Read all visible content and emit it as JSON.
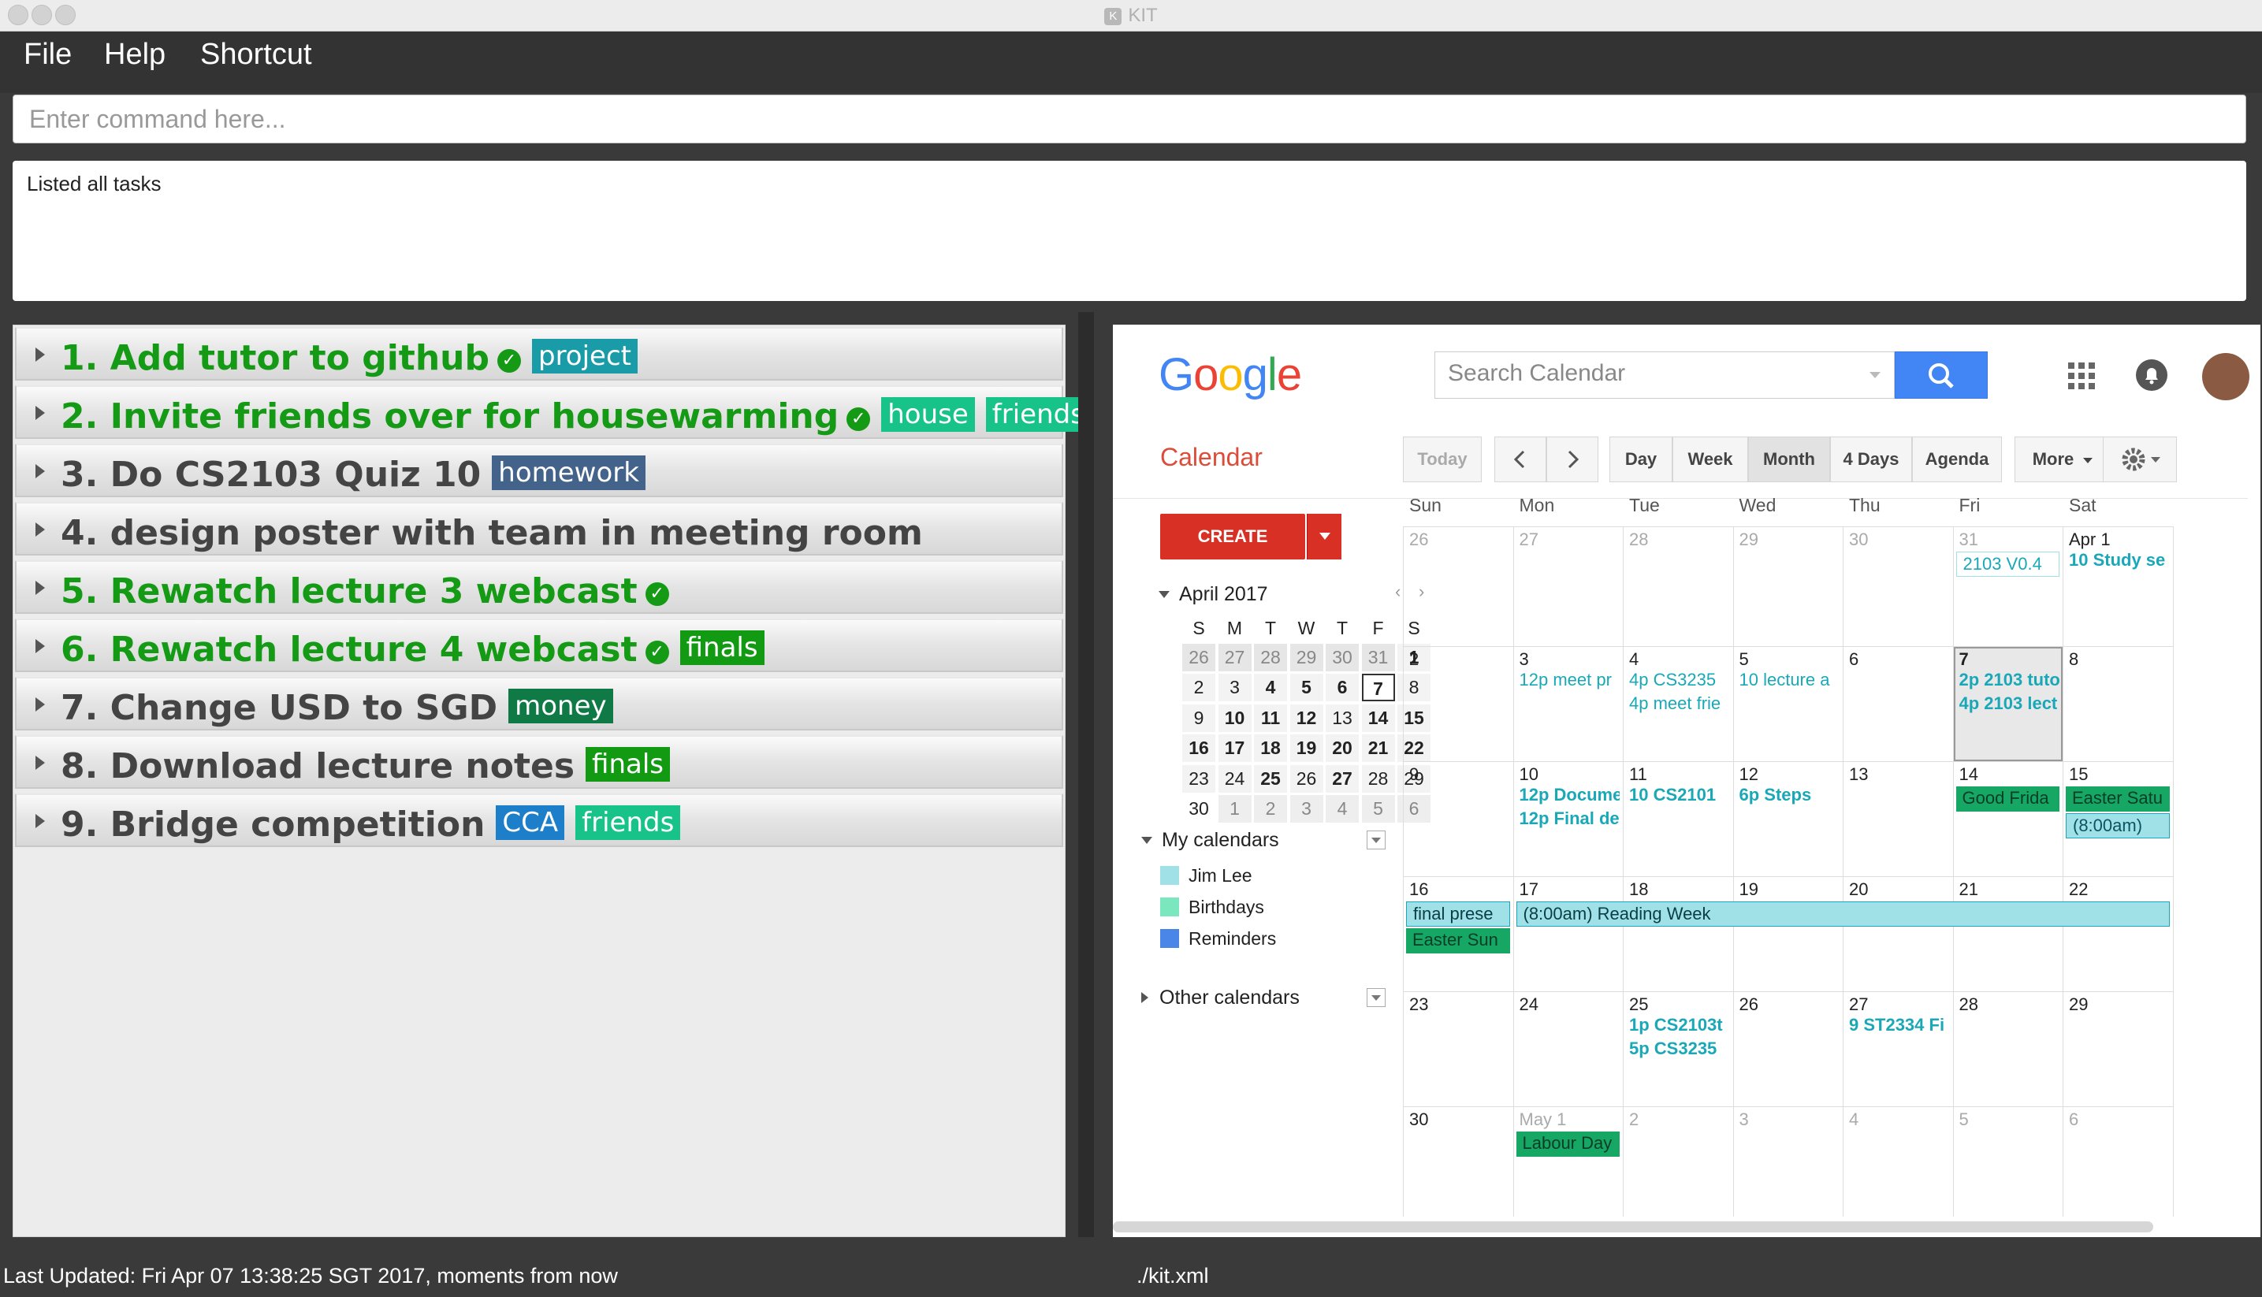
{
  "window": {
    "title": "KIT",
    "app_badge": "K"
  },
  "menu": {
    "file": "File",
    "help": "Help",
    "shortcut": "Shortcut"
  },
  "command": {
    "placeholder": "Enter command here..."
  },
  "result": {
    "text": "Listed all tasks"
  },
  "tasks": [
    {
      "title": "1. Add tutor to github",
      "done": true,
      "tags": [
        "project"
      ]
    },
    {
      "title": "2. Invite friends over for housewarming",
      "done": true,
      "tags": [
        "house",
        "friends"
      ]
    },
    {
      "title": "3. Do CS2103 Quiz 10",
      "done": false,
      "tags": [
        "homework"
      ]
    },
    {
      "title": "4. design poster with team in meeting room",
      "done": false,
      "tags": []
    },
    {
      "title": "5. Rewatch lecture 3 webcast",
      "done": true,
      "tags": []
    },
    {
      "title": "6. Rewatch lecture 4 webcast",
      "done": true,
      "tags": [
        "finals"
      ]
    },
    {
      "title": "7. Change USD to SGD",
      "done": false,
      "tags": [
        "money"
      ]
    },
    {
      "title": "8. Download lecture notes",
      "done": false,
      "tags": [
        "finals"
      ]
    },
    {
      "title": "9. Bridge competition",
      "done": false,
      "tags": [
        "CCA",
        "friends"
      ]
    }
  ],
  "tag_colors": {
    "project": "#1a9ba8",
    "house": "#18c38a",
    "friends": "#18c38a",
    "homework": "#43638a",
    "finals": "#129a12",
    "money": "#0f7a45",
    "CCA": "#1d7fc9"
  },
  "calendar": {
    "logo": "Google",
    "search_placeholder": "Search Calendar",
    "label": "Calendar",
    "buttons": {
      "today": "Today",
      "day": "Day",
      "week": "Week",
      "month": "Month",
      "four_days": "4 Days",
      "agenda": "Agenda",
      "more": "More"
    },
    "create": "CREATE",
    "mini_month": "April 2017",
    "mini_dow": [
      "S",
      "M",
      "T",
      "W",
      "T",
      "F",
      "S"
    ],
    "mini_days": [
      [
        "26",
        "27",
        "28",
        "29",
        "30",
        "31",
        "1"
      ],
      [
        "2",
        "3",
        "4",
        "5",
        "6",
        "7",
        "8"
      ],
      [
        "9",
        "10",
        "11",
        "12",
        "13",
        "14",
        "15"
      ],
      [
        "16",
        "17",
        "18",
        "19",
        "20",
        "21",
        "22"
      ],
      [
        "23",
        "24",
        "25",
        "26",
        "27",
        "28",
        "29"
      ],
      [
        "30",
        "1",
        "2",
        "3",
        "4",
        "5",
        "6"
      ]
    ],
    "my_calendars": "My calendars",
    "calendars": [
      {
        "name": "Jim Lee",
        "color": "#9fe1e7"
      },
      {
        "name": "Birthdays",
        "color": "#7ae7bf"
      },
      {
        "name": "Reminders",
        "color": "#4986e7"
      }
    ],
    "other_calendars": "Other calendars",
    "dow": [
      "Sun",
      "Mon",
      "Tue",
      "Wed",
      "Thu",
      "Fri",
      "Sat"
    ],
    "weeks": [
      [
        "26",
        "27",
        "28",
        "29",
        "30",
        "31",
        "Apr 1"
      ],
      [
        "2",
        "3",
        "4",
        "5",
        "6",
        "7",
        "8"
      ],
      [
        "9",
        "10",
        "11",
        "12",
        "13",
        "14",
        "15"
      ],
      [
        "16",
        "17",
        "18",
        "19",
        "20",
        "21",
        "22"
      ],
      [
        "23",
        "24",
        "25",
        "26",
        "27",
        "28",
        "29"
      ],
      [
        "30",
        "May 1",
        "2",
        "3",
        "4",
        "5",
        "6"
      ]
    ],
    "events": {
      "e_fri31": "2103 V0.4",
      "e_apr1": "10 Study se",
      "e_mon3": "12p meet pr",
      "e_tue4a": "4p CS3235",
      "e_tue4b": "4p meet frie",
      "e_wed5": "10 lecture a",
      "e_fri7a": "2p 2103 tuto",
      "e_fri7b": "4p 2103 lect",
      "e_mon10a": "12p Docume",
      "e_mon10b": "12p Final de",
      "e_tue11": "10 CS2101",
      "e_wed12": "6p Steps",
      "e_fri14": "Good Frida",
      "e_sat15a": "Easter Satu",
      "e_sat15b": "(8:00am)",
      "e_sun16a": "final prese",
      "e_reading": "(8:00am) Reading Week",
      "e_sun16b": "Easter Sun",
      "e_tue25a": "1p CS2103t",
      "e_tue25b": "5p CS3235",
      "e_thu27": "9 ST2334 Fi",
      "e_may1": "Labour Day"
    }
  },
  "status": {
    "last_updated": "Last Updated: Fri Apr 07 13:38:25 SGT 2017, moments from now",
    "file": "./kit.xml"
  }
}
